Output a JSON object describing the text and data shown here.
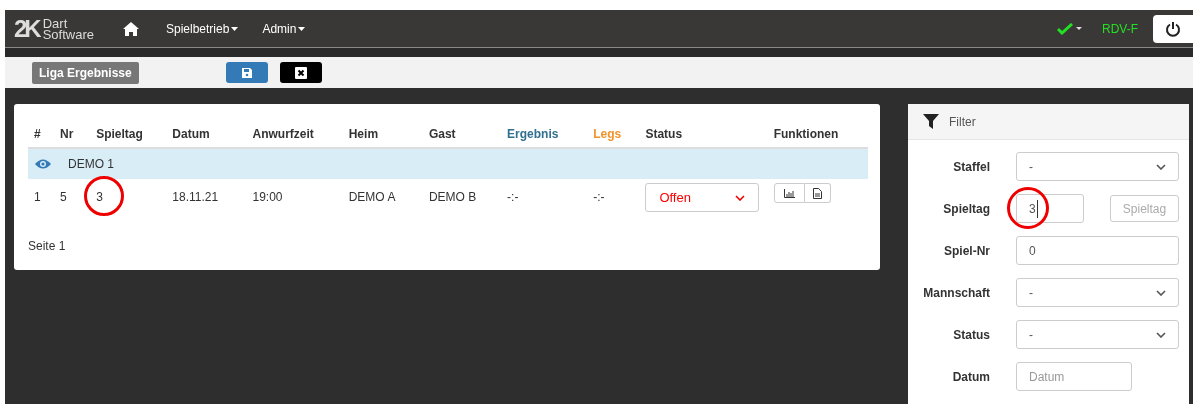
{
  "navbar": {
    "logo_mark": "2K",
    "logo_line1": "Dart",
    "logo_line2": "Software",
    "menus": [
      "Spielbetrieb",
      "Admin"
    ],
    "user": "RDV-F"
  },
  "toolbar": {
    "title": "Liga Ergebnisse"
  },
  "table": {
    "columns": [
      {
        "label": "#",
        "kind": "plain"
      },
      {
        "label": "Nr",
        "kind": "plain"
      },
      {
        "label": "Spieltag",
        "kind": "plain"
      },
      {
        "label": "Datum",
        "kind": "plain"
      },
      {
        "label": "Anwurfzeit",
        "kind": "plain"
      },
      {
        "label": "Heim",
        "kind": "plain"
      },
      {
        "label": "Gast",
        "kind": "plain"
      },
      {
        "label": "Ergebnis",
        "kind": "result"
      },
      {
        "label": "Legs",
        "kind": "legs"
      },
      {
        "label": "Status",
        "kind": "plain"
      },
      {
        "label": "Funktionen",
        "kind": "plain"
      }
    ],
    "group": "DEMO 1",
    "rows": [
      {
        "cells": [
          {
            "text": "1",
            "circled": false
          },
          {
            "text": "5",
            "circled": false
          },
          {
            "text": "3",
            "circled": true
          },
          {
            "text": "18.11.21",
            "circled": false
          },
          {
            "text": "19:00",
            "circled": false
          },
          {
            "text": "DEMO A",
            "circled": false
          },
          {
            "text": "DEMO B",
            "circled": false
          },
          {
            "text": "-:-",
            "circled": false
          },
          {
            "text": "-:-",
            "circled": false
          }
        ],
        "status": "Offen"
      }
    ],
    "footer": "Seite 1"
  },
  "filter": {
    "title": "Filter",
    "fields": [
      {
        "kind": "select",
        "label": "Staffel",
        "value": "-"
      },
      {
        "kind": "input_button",
        "label": "Spieltag",
        "value": "3",
        "circled": true,
        "button_placeholder": "Spieltag"
      },
      {
        "kind": "input",
        "label": "Spiel-Nr",
        "value": "0"
      },
      {
        "kind": "select",
        "label": "Mannschaft",
        "value": "-"
      },
      {
        "kind": "select",
        "label": "Status",
        "value": "-"
      },
      {
        "kind": "date",
        "label": "Datum",
        "placeholder": "Datum"
      }
    ]
  }
}
